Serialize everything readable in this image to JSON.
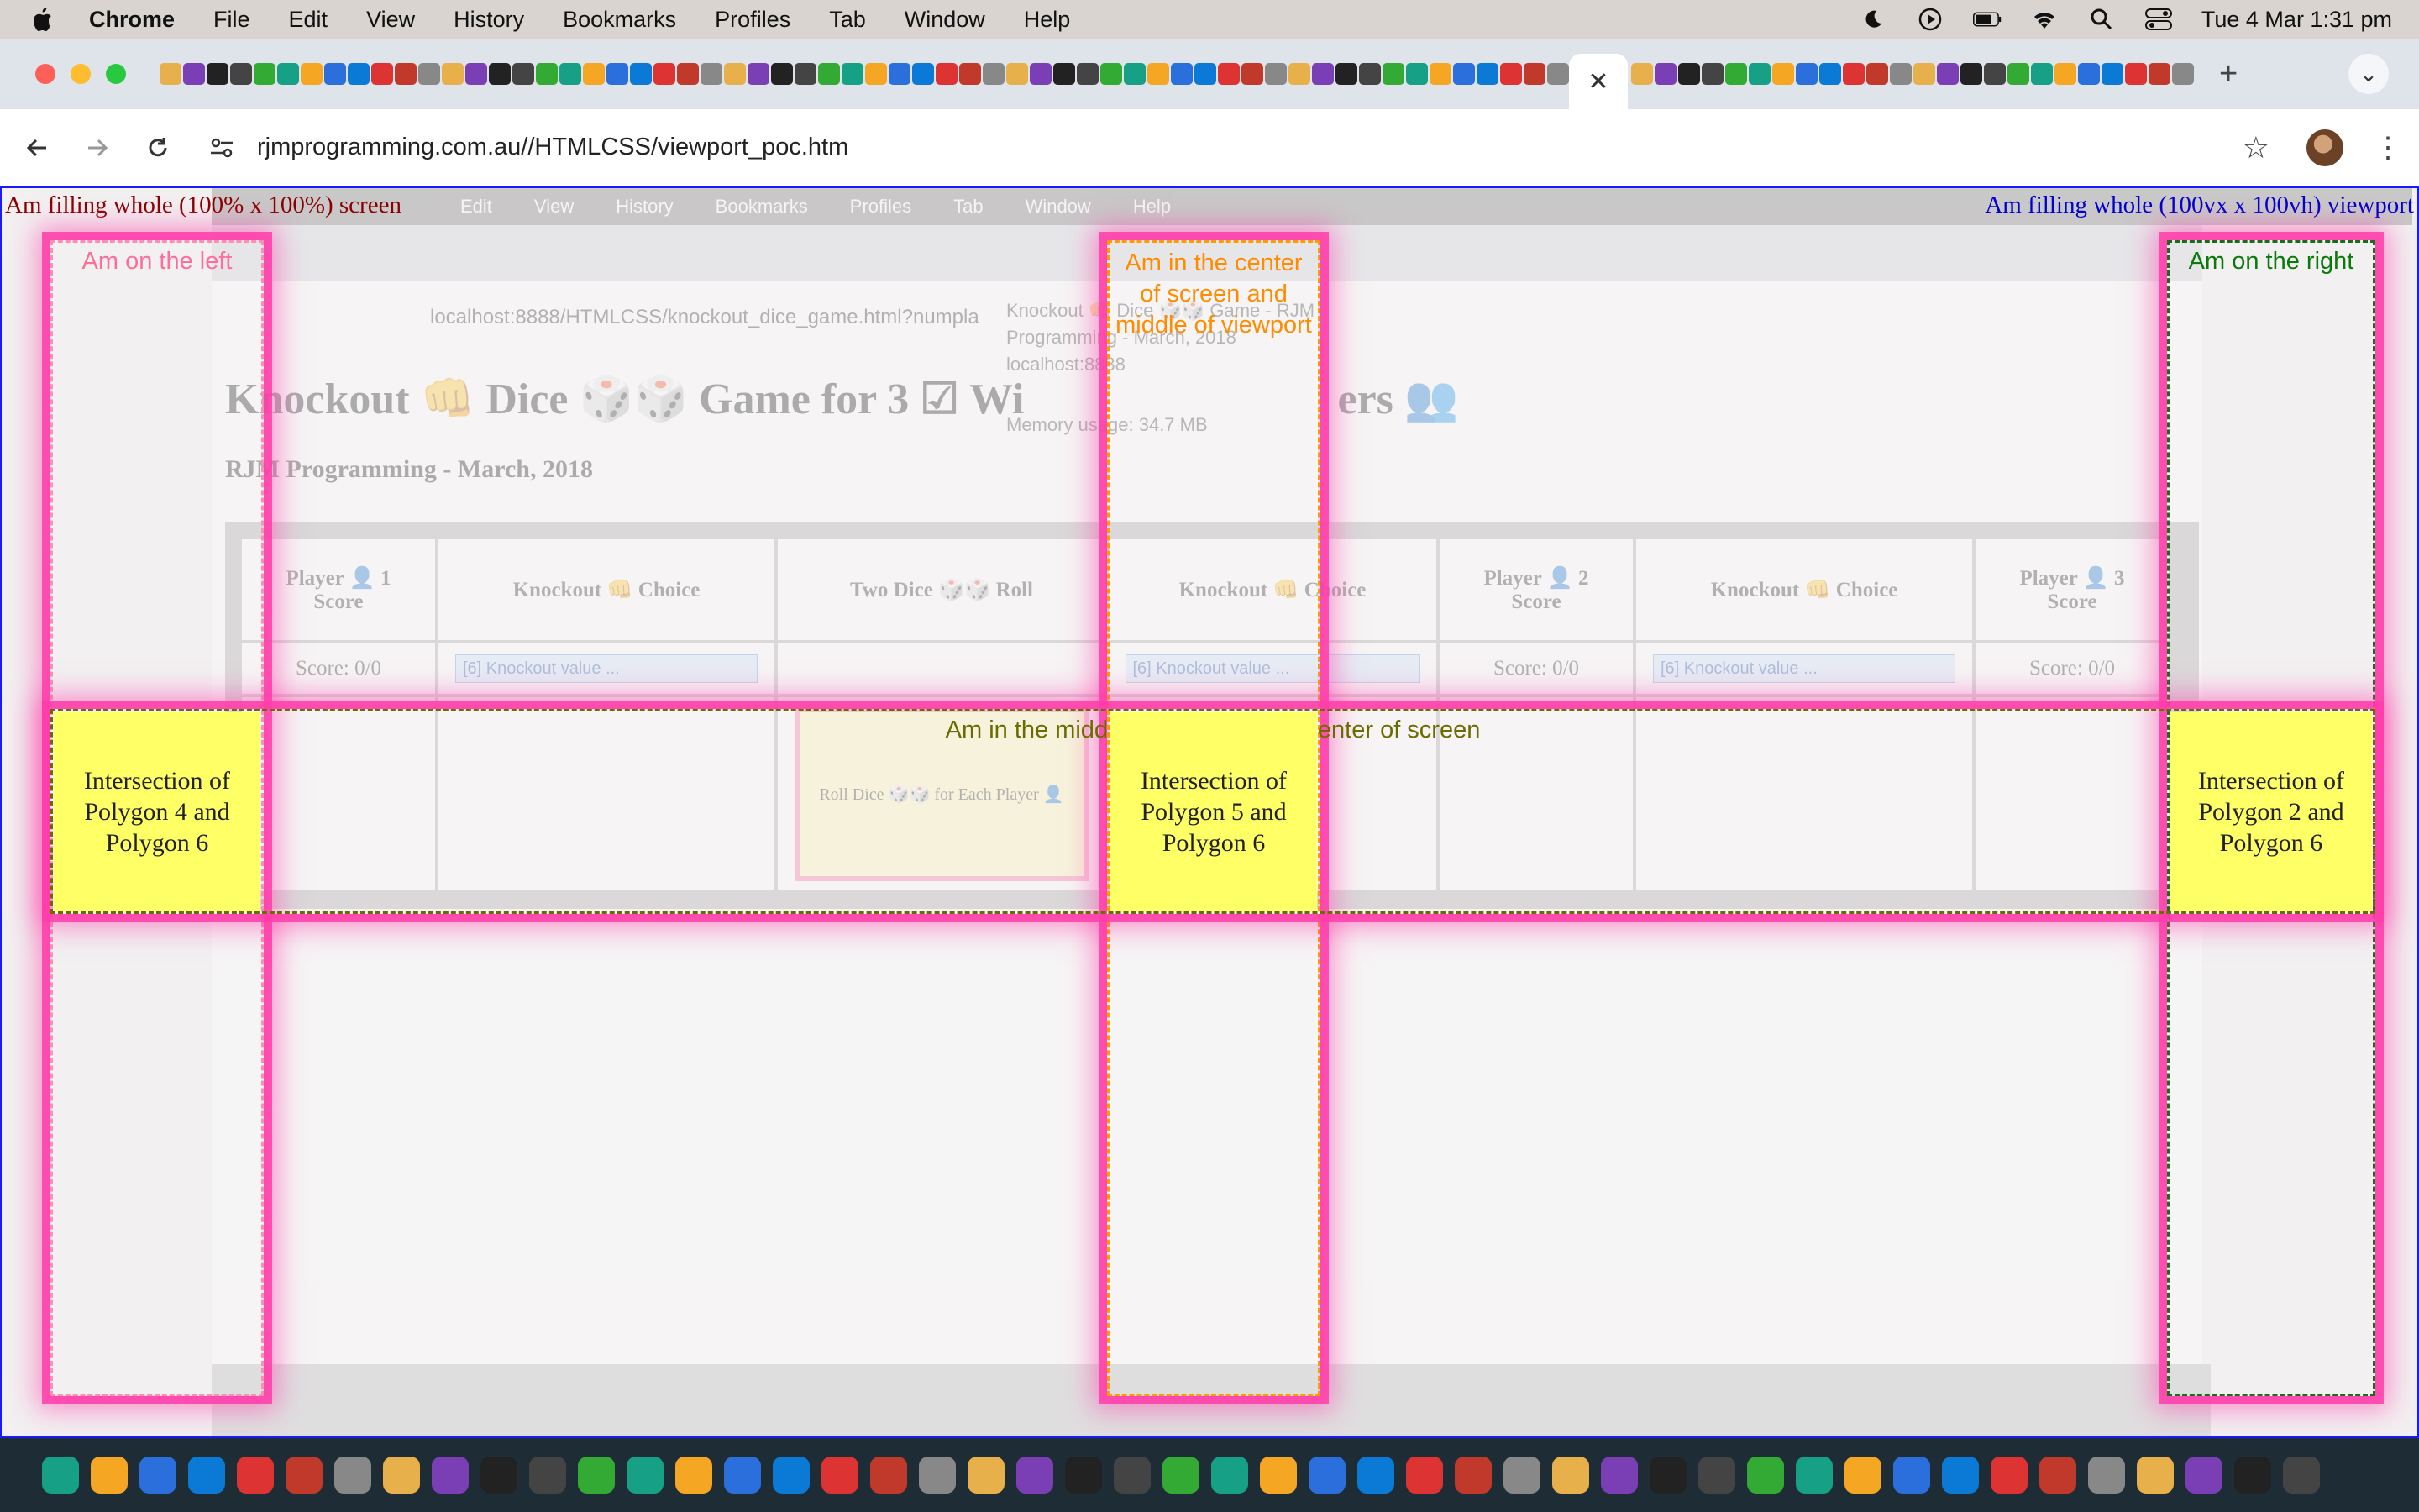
{
  "menubar": {
    "app": "Chrome",
    "items": [
      "File",
      "Edit",
      "View",
      "History",
      "Bookmarks",
      "Profiles",
      "Tab",
      "Window",
      "Help"
    ],
    "clock": "Tue 4 Mar  1:31 pm"
  },
  "browser": {
    "url": "rjmprogramming.com.au//HTMLCSS/viewport_poc.htm",
    "tab_close": "✕",
    "new_tab": "+"
  },
  "background_page": {
    "url": "localhost:8888/HTMLCSS/knockout_dice_game.html?numpla",
    "menu_items": [
      "Edit",
      "View",
      "History",
      "Bookmarks",
      "Profiles",
      "Tab",
      "Window",
      "Help"
    ],
    "title": "Knockout 👊 Dice 🎲🎲 Game for 3 ☑ Wi",
    "title_tail": "ers 👥",
    "subtitle": "RJM Programming - March, 2018",
    "tab_tooltip": "Knockout 👊 Dice 🎲🎲 Game - RJM Programming - March, 2018",
    "tooltip_host": "localhost:8888",
    "memory": "Memory usage: 34.7 MB",
    "headers": [
      "Player 👤 1\nScore",
      "Knockout 👊 Choice",
      "Two Dice 🎲🎲 Roll",
      "Knockout 👊 Choice",
      "Player 👤 2\nScore",
      "Knockout 👊 Choice",
      "Player 👤 3\nScore"
    ],
    "score_text": "Score: 0/0",
    "select_text": "[6] Knockout value ...",
    "roll_text": "Roll Dice 🎲🎲 for Each Player 👤"
  },
  "overlay": {
    "full_screen": "Am filling whole (100% x 100%) screen",
    "full_viewport": "Am filling whole (100vx x 100vh) viewport",
    "left": "Am on the left",
    "center": "Am in the center of screen and middle of viewport",
    "right": "Am on the right",
    "middle": "Am in the middle of viewport and center of screen",
    "isect_4_6": "Intersection of Polygon 4 and Polygon 6",
    "isect_5_6": "Intersection of Polygon 5 and Polygon 6",
    "isect_2_6": "Intersection of Polygon 2 and Polygon 6"
  },
  "colors": {
    "glow": "#ff3caa",
    "intersection": "#ffff66",
    "left_label": "#ff6e9a",
    "center_label": "#ff8c00",
    "right_label": "#0a7a0a",
    "middle_label": "#6b6b00",
    "screen_label": "#8b0000",
    "viewport_label": "#0000d0"
  }
}
